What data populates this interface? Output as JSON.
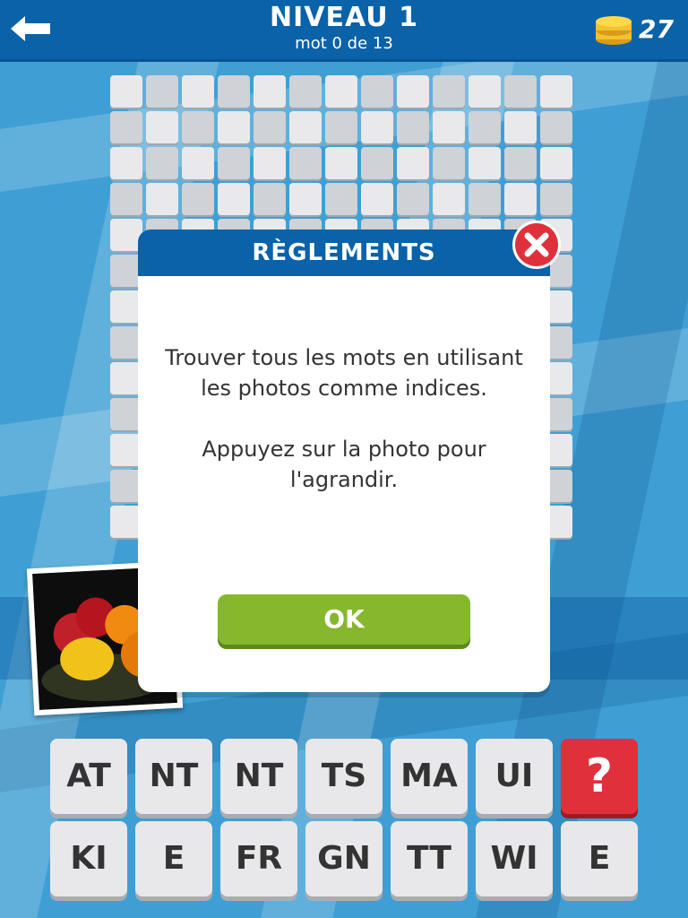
{
  "header": {
    "title": "NIVEAU 1",
    "subtitle": "mot 0 de 13",
    "coins": "27",
    "back_icon": "arrow-left-icon",
    "coin_icon": "coins-icon"
  },
  "grid": {
    "rows": 13,
    "cols": 13
  },
  "photo": {
    "description_icon": "fruit-photo"
  },
  "modal": {
    "title": "RÈGLEMENTS",
    "paragraph1": "Trouver tous les mots en utilisant les photos comme indices.",
    "paragraph2": "Appuyez sur la photo pour l'agrandir.",
    "ok_label": "OK",
    "close_icon": "close-icon"
  },
  "tiles": {
    "row1": [
      "AT",
      "NT",
      "NT",
      "TS",
      "MA",
      "UI",
      "?"
    ],
    "row2": [
      "KI",
      "E",
      "FR",
      "GN",
      "TT",
      "WI",
      "E"
    ]
  },
  "colors": {
    "header": "#0a62a8",
    "ok": "#86b82d",
    "hint": "#e0303c",
    "background": "#3f9fd4"
  }
}
